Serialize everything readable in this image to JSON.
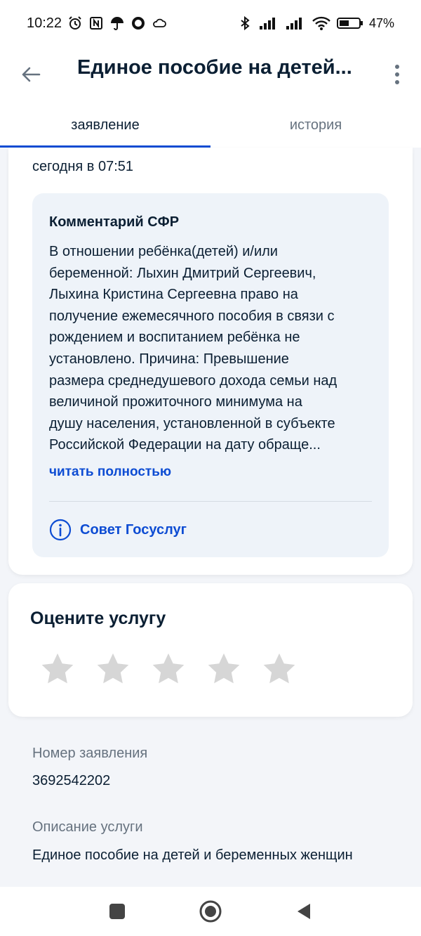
{
  "status_bar": {
    "time": "10:22",
    "battery": "47%",
    "icons_left": [
      "alarm-icon",
      "nfc-icon",
      "umbrella-icon",
      "circle-icon",
      "cloud-icon"
    ],
    "icons_right": [
      "bluetooth-icon",
      "signal-icon",
      "signal-icon",
      "wifi-icon",
      "battery-icon"
    ]
  },
  "app_bar": {
    "title": "Единое пособие на детей...",
    "back_icon": "arrow-left-icon",
    "menu_icon": "more-vertical-icon"
  },
  "tabs": [
    {
      "label": "заявление",
      "active": true
    },
    {
      "label": "история",
      "active": false
    }
  ],
  "status_card": {
    "date": "сегодня в 07:51",
    "comment": {
      "title": "Комментарий СФР",
      "lines": [
        "В отношении ребёнка(детей) и/или",
        "беременной: Лыхин Дмитрий Сергеевич,",
        "Лыхина Кристина Сергеевна право на",
        "получение ежемесячного пособия в связи с",
        "рождением и воспитанием ребёнка не",
        "установлено. Причина: Превышение",
        "размера среднедушевого дохода семьи над",
        "величиной прожиточного минимума на",
        "душу населения, установленной в субъекте",
        "Российской Федерации на дату обраще..."
      ],
      "read_more": "читать полностью",
      "advice_label": "Совет Госуслуг",
      "advice_icon": "info-circle-icon"
    }
  },
  "rating": {
    "title": "Оцените услугу",
    "stars_total": 5,
    "stars_selected": 0
  },
  "details": {
    "number_label": "Номер заявления",
    "number_value": "3692542202",
    "description_label": "Описание услуги",
    "description_value": "Единое пособие на детей и беременных женщин"
  },
  "colors": {
    "accent": "#0d4cd3",
    "background": "#f3f5f9",
    "comment_bg": "#eef3f9",
    "star": "#d6d6d6",
    "muted": "#66727f"
  }
}
